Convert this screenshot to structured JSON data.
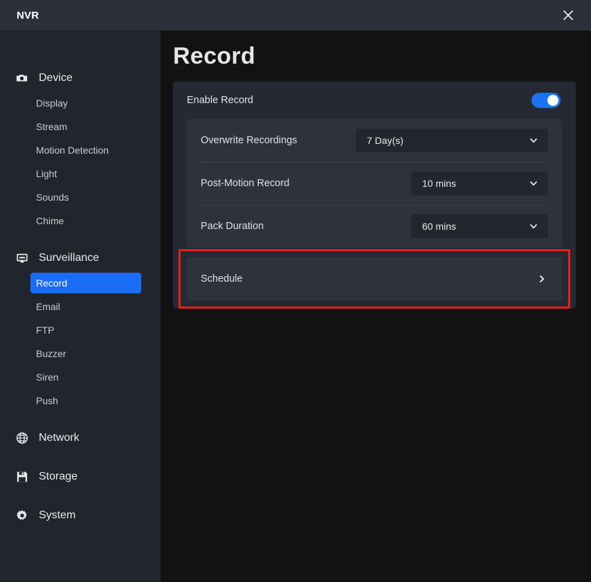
{
  "window": {
    "title": "NVR",
    "close_icon": "close-icon"
  },
  "sidebar": {
    "groups": [
      {
        "label": "Device",
        "icon": "camera-icon",
        "items": [
          {
            "label": "Display",
            "active": false
          },
          {
            "label": "Stream",
            "active": false
          },
          {
            "label": "Motion Detection",
            "active": false
          },
          {
            "label": "Light",
            "active": false
          },
          {
            "label": "Sounds",
            "active": false
          },
          {
            "label": "Chime",
            "active": false
          }
        ]
      },
      {
        "label": "Surveillance",
        "icon": "monitor-icon",
        "items": [
          {
            "label": "Record",
            "active": true
          },
          {
            "label": "Email",
            "active": false
          },
          {
            "label": "FTP",
            "active": false
          },
          {
            "label": "Buzzer",
            "active": false
          },
          {
            "label": "Siren",
            "active": false
          },
          {
            "label": "Push",
            "active": false
          }
        ]
      },
      {
        "label": "Network",
        "icon": "globe-icon",
        "items": []
      },
      {
        "label": "Storage",
        "icon": "floppy-disk-icon",
        "items": []
      },
      {
        "label": "System",
        "icon": "gear-icon",
        "items": []
      }
    ]
  },
  "main": {
    "page_title": "Record",
    "enable": {
      "label": "Enable Record",
      "toggle_state": "on"
    },
    "settings": [
      {
        "label": "Overwrite Recordings",
        "value": "7 Day(s)",
        "width": "wide",
        "chevron_icon": "chevron-down-icon"
      },
      {
        "label": "Post-Motion Record",
        "value": "10 mins",
        "width": "narrow",
        "chevron_icon": "chevron-down-icon"
      },
      {
        "label": "Pack Duration",
        "value": "60 mins",
        "width": "narrow",
        "chevron_icon": "chevron-down-icon"
      }
    ],
    "schedule": {
      "label": "Schedule",
      "arrow_icon": "chevron-right-icon",
      "highlighted": true
    }
  },
  "colors": {
    "titlebar_bg": "#2b303b",
    "sidebar_bg": "#21252e",
    "main_bg": "#121212",
    "card_bg": "#252934",
    "group_bg": "#2d323d",
    "select_bg": "#23262f",
    "accent_blue": "#1a6cf5",
    "toggle_blue": "#1a73f0",
    "highlight_red": "#f01e13"
  }
}
